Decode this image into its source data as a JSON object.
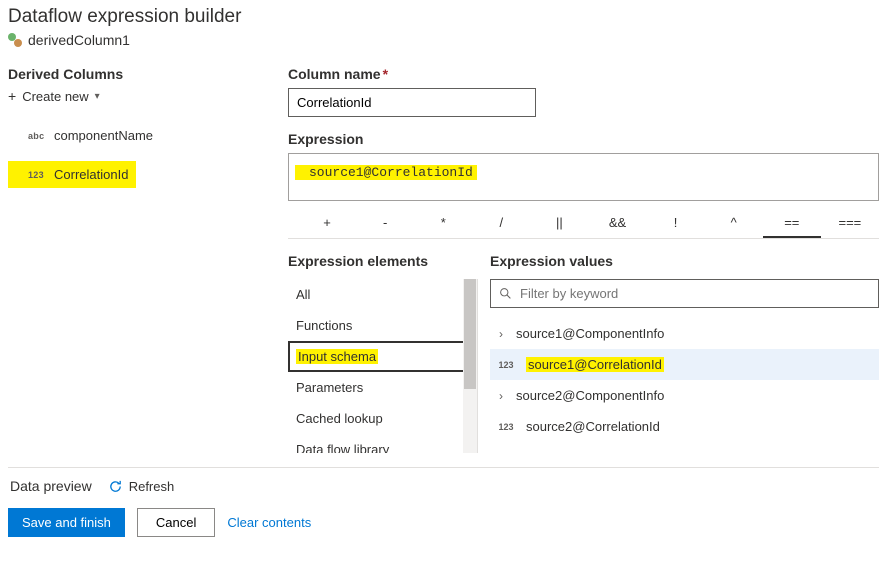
{
  "header": {
    "title": "Dataflow expression builder",
    "node_name": "derivedColumn1"
  },
  "left_panel": {
    "section_label": "Derived Columns",
    "create_label": "Create new",
    "columns": [
      {
        "type": "abc",
        "name": "componentName",
        "highlighted": false
      },
      {
        "type": "123",
        "name": "CorrelationId",
        "highlighted": true
      }
    ]
  },
  "right_panel": {
    "column_name_label": "Column name",
    "column_name_value": "CorrelationId",
    "expression_label": "Expression",
    "expression_value": "source1@CorrelationId",
    "operators": [
      "+",
      "-",
      "*",
      "/",
      "||",
      "&&",
      "!",
      "^",
      "==",
      "==="
    ]
  },
  "elements_panel": {
    "title": "Expression elements",
    "items": [
      "All",
      "Functions",
      "Input schema",
      "Parameters",
      "Cached lookup",
      "Data flow library"
    ],
    "selected_index": 2
  },
  "values_panel": {
    "title": "Expression values",
    "filter_placeholder": "Filter by keyword",
    "items": [
      {
        "icon": "chev",
        "label": "source1@ComponentInfo",
        "active": false
      },
      {
        "icon": "123",
        "label": "source1@CorrelationId",
        "active": true,
        "highlighted": true
      },
      {
        "icon": "chev",
        "label": "source2@ComponentInfo",
        "active": false
      },
      {
        "icon": "123",
        "label": "source2@CorrelationId",
        "active": false
      }
    ]
  },
  "footer": {
    "preview_label": "Data preview",
    "refresh_label": "Refresh",
    "save_label": "Save and finish",
    "cancel_label": "Cancel",
    "clear_label": "Clear contents"
  }
}
